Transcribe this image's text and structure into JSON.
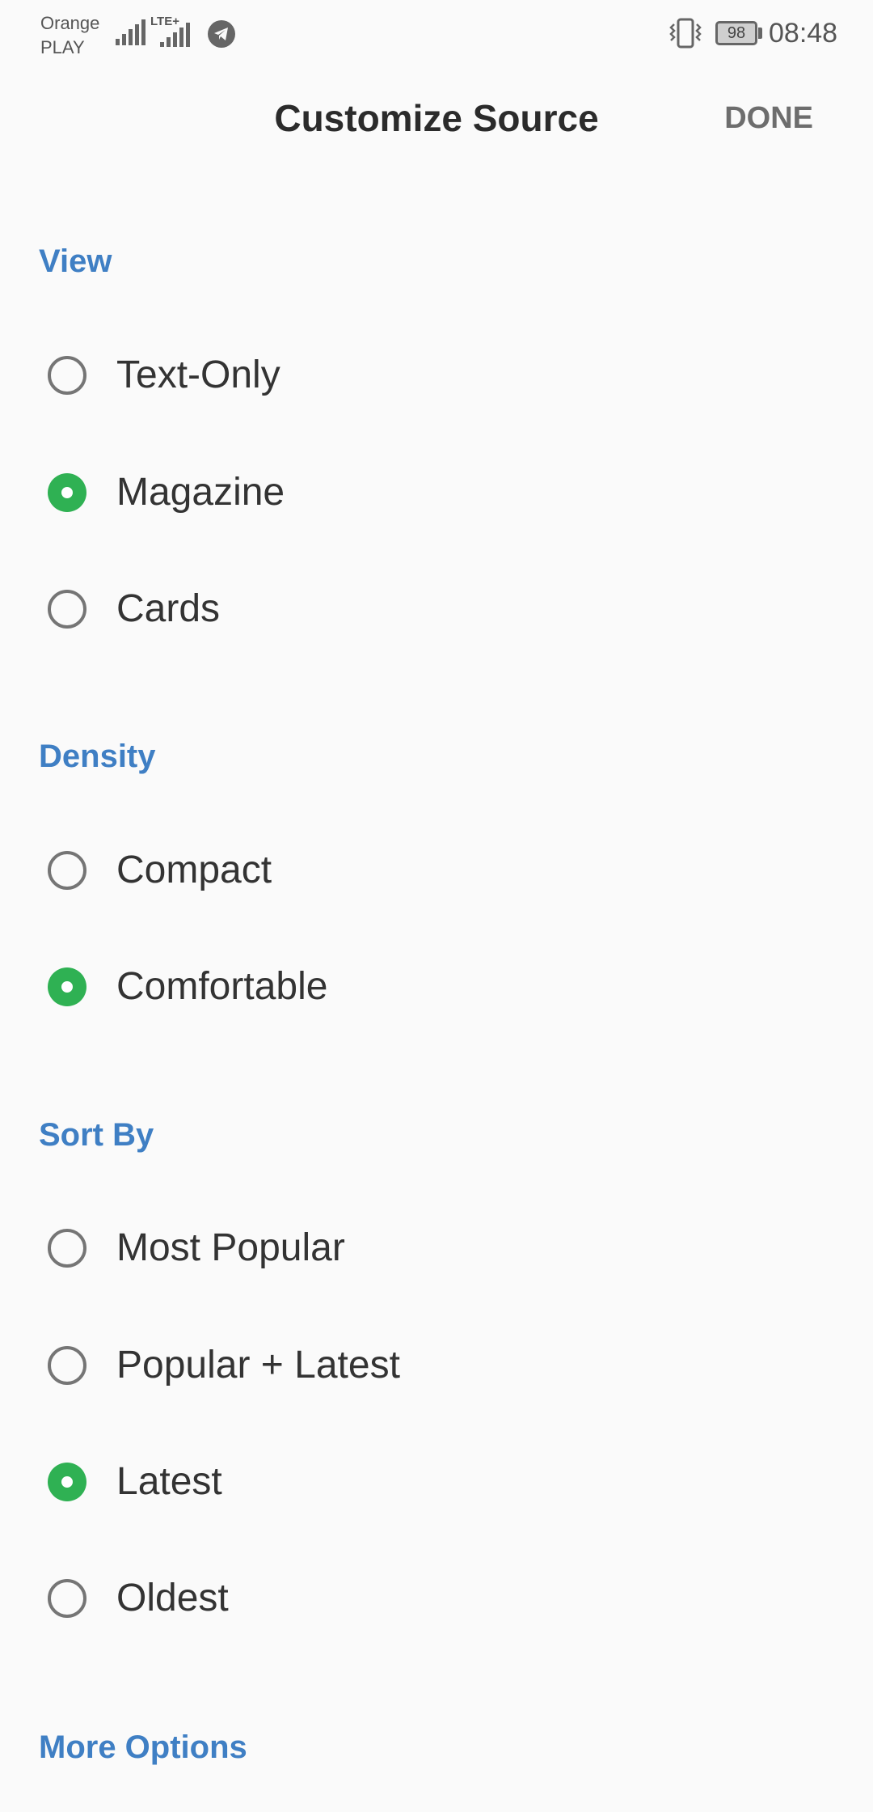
{
  "status_bar": {
    "carrier_line1": "Orange",
    "carrier_line2": "PLAY",
    "lte_label": "LTE+",
    "battery_level": "98",
    "time": "08:48",
    "icons": [
      "signal-icon",
      "lte-signal-icon",
      "telegram-icon",
      "vibrate-icon",
      "battery-icon"
    ]
  },
  "header": {
    "title": "Customize Source",
    "done_label": "DONE"
  },
  "sections": {
    "view": {
      "title": "View",
      "options": [
        {
          "label": "Text-Only",
          "selected": false
        },
        {
          "label": "Magazine",
          "selected": true
        },
        {
          "label": "Cards",
          "selected": false
        }
      ]
    },
    "density": {
      "title": "Density",
      "options": [
        {
          "label": "Compact",
          "selected": false
        },
        {
          "label": "Comfortable",
          "selected": true
        }
      ]
    },
    "sort_by": {
      "title": "Sort By",
      "options": [
        {
          "label": "Most Popular",
          "selected": false
        },
        {
          "label": "Popular + Latest",
          "selected": false
        },
        {
          "label": "Latest",
          "selected": true
        },
        {
          "label": "Oldest",
          "selected": false
        }
      ]
    },
    "more_options": {
      "title": "More Options"
    }
  },
  "colors": {
    "accent": "#3f7fc4",
    "radio_selected": "#2fb153",
    "background": "#fafafa"
  }
}
